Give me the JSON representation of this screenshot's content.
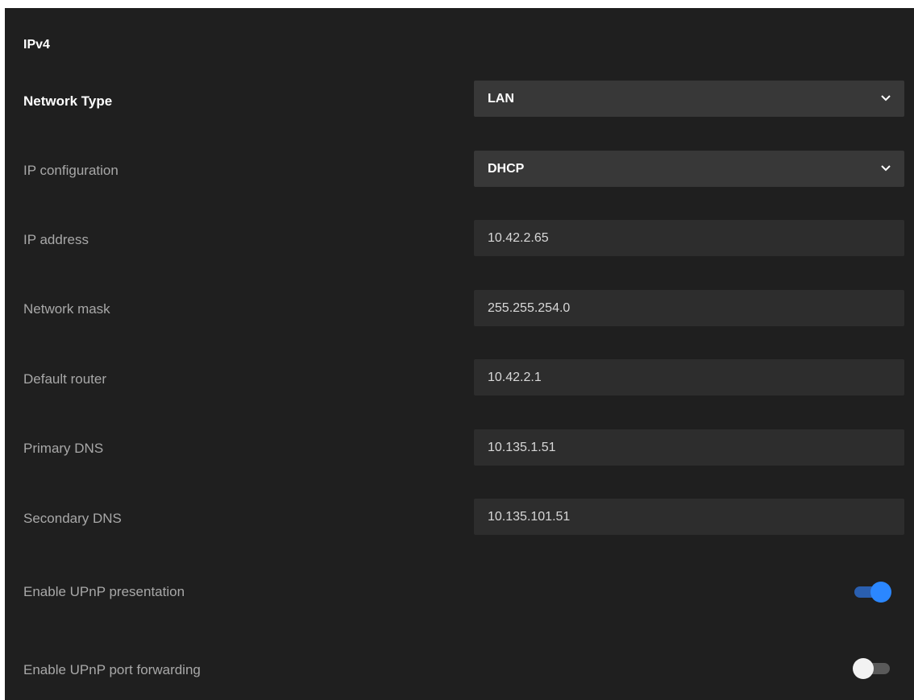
{
  "section": {
    "title": "IPv4"
  },
  "network_type": {
    "label": "Network Type",
    "value": "LAN",
    "icon": "chevron-down-icon"
  },
  "ip_configuration": {
    "label": "IP configuration",
    "value": "DHCP",
    "icon": "chevron-down-icon"
  },
  "ip_address": {
    "label": "IP address",
    "value": "10.42.2.65"
  },
  "network_mask": {
    "label": "Network mask",
    "value": "255.255.254.0"
  },
  "default_router": {
    "label": "Default router",
    "value": "10.42.2.1"
  },
  "primary_dns": {
    "label": "Primary DNS",
    "value": "10.135.1.51"
  },
  "secondary_dns": {
    "label": "Secondary DNS",
    "value": "10.135.101.51"
  },
  "upnp_presentation": {
    "label": "Enable UPnP presentation",
    "enabled": true
  },
  "upnp_port_forwarding": {
    "label": "Enable UPnP port forwarding",
    "enabled": false
  },
  "colors": {
    "background": "#1f1f1f",
    "select_bg": "#383838",
    "field_bg": "#2d2d2d",
    "toggle_on": "#2b87ff",
    "toggle_off_knob": "#f2f2f2"
  }
}
